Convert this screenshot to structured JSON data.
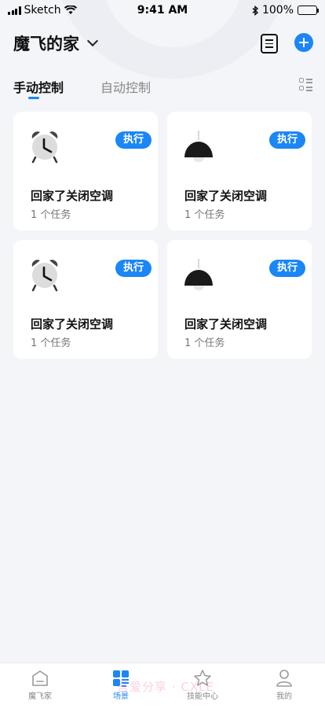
{
  "status_bar": {
    "carrier": "Sketch",
    "time": "9:41 AM",
    "battery": "100%"
  },
  "header": {
    "home_name": "魔飞的家"
  },
  "tabs": [
    {
      "label": "手动控制"
    },
    {
      "label": "自动控制"
    }
  ],
  "scenes": [
    {
      "title": "回家了关闭空调",
      "subtitle": "1 个任务",
      "action": "执行",
      "icon": "alarm-clock-icon"
    },
    {
      "title": "回家了关闭空调",
      "subtitle": "1 个任务",
      "action": "执行",
      "icon": "pendant-lamp-icon"
    },
    {
      "title": "回家了关闭空调",
      "subtitle": "1 个任务",
      "action": "执行",
      "icon": "alarm-clock-icon"
    },
    {
      "title": "回家了关闭空调",
      "subtitle": "1 个任务",
      "action": "执行",
      "icon": "pendant-lamp-icon"
    }
  ],
  "bottom_nav": [
    {
      "label": "魔飞家",
      "icon": "home-icon"
    },
    {
      "label": "场景",
      "icon": "scene-icon"
    },
    {
      "label": "技能中心",
      "icon": "star-icon"
    },
    {
      "label": "我的",
      "icon": "user-icon"
    }
  ],
  "watermark": "吾爱分享 · CXLE",
  "colors": {
    "accent": "#1b86f5",
    "background": "#f4f5f8",
    "card": "#ffffff"
  }
}
